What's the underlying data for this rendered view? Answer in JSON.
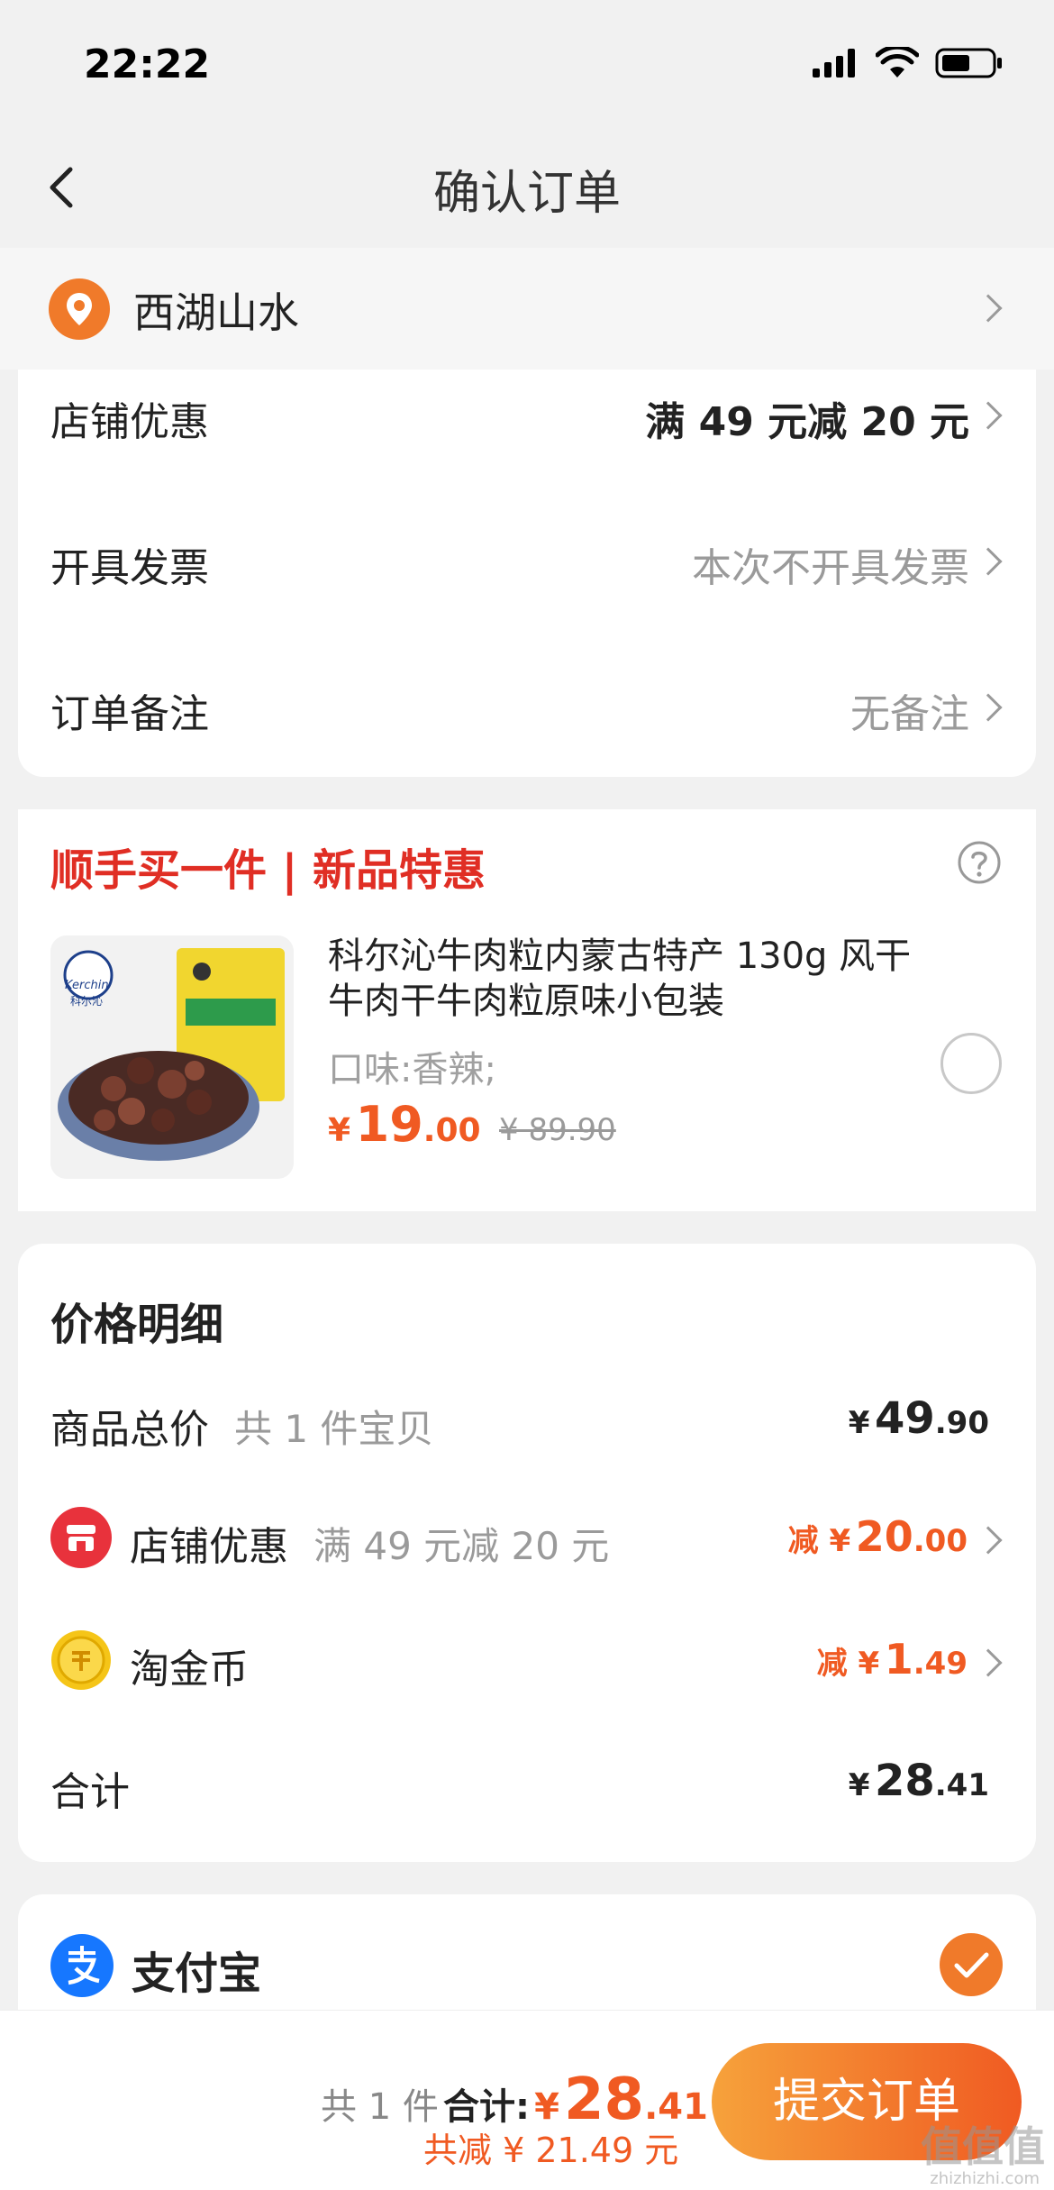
{
  "status": {
    "time": "22:22"
  },
  "nav": {
    "title": "确认订单"
  },
  "address": {
    "text": "西湖山水"
  },
  "order_options": [
    {
      "label": "店铺优惠",
      "value": "满 49 元减 20 元"
    },
    {
      "label": "开具发票",
      "value": "本次不开具发票"
    },
    {
      "label": "订单备注",
      "value": "无备注"
    }
  ],
  "addon": {
    "title": "顺手买一件 | 新品特惠",
    "product": {
      "title": "科尔沁牛肉粒内蒙古特产 130g 风干牛肉干牛肉粒原味小包装",
      "spec": "口味:香辣;",
      "currency": "¥",
      "price_int": "19",
      "price_dec": ".00",
      "old_price": "¥ 89.90",
      "brand": "Kerchin",
      "brand_cn": "科尔沁"
    }
  },
  "price_detail": {
    "title": "价格明细",
    "goods_label": "商品总价",
    "goods_sub": "共 1 件宝贝",
    "goods_currency": "¥",
    "goods_int": "49",
    "goods_dec": ".90",
    "shop_label": "店铺优惠",
    "shop_sub": "满 49 元减 20 元",
    "shop_prefix": "减 ¥",
    "shop_int": "20",
    "shop_dec": ".00",
    "coin_label": "淘金币",
    "coin_prefix": "减 ¥",
    "coin_int": "1",
    "coin_dec": ".49",
    "total_label": "合计",
    "total_currency": "¥",
    "total_int": "28",
    "total_dec": ".41"
  },
  "payment": {
    "label": "支付宝"
  },
  "bottom": {
    "count": "共 1 件",
    "total_label": "合计:",
    "currency": "¥",
    "total_int": "28",
    "total_dec": ".41",
    "saved": "共减 ¥ 21.49 元",
    "submit": "提交订单"
  },
  "watermark": {
    "text": "值值值",
    "site": "zhizhizhi.com"
  },
  "colors": {
    "accent": "#f05a22",
    "red": "#e02e24",
    "alipay": "#1677ff"
  }
}
